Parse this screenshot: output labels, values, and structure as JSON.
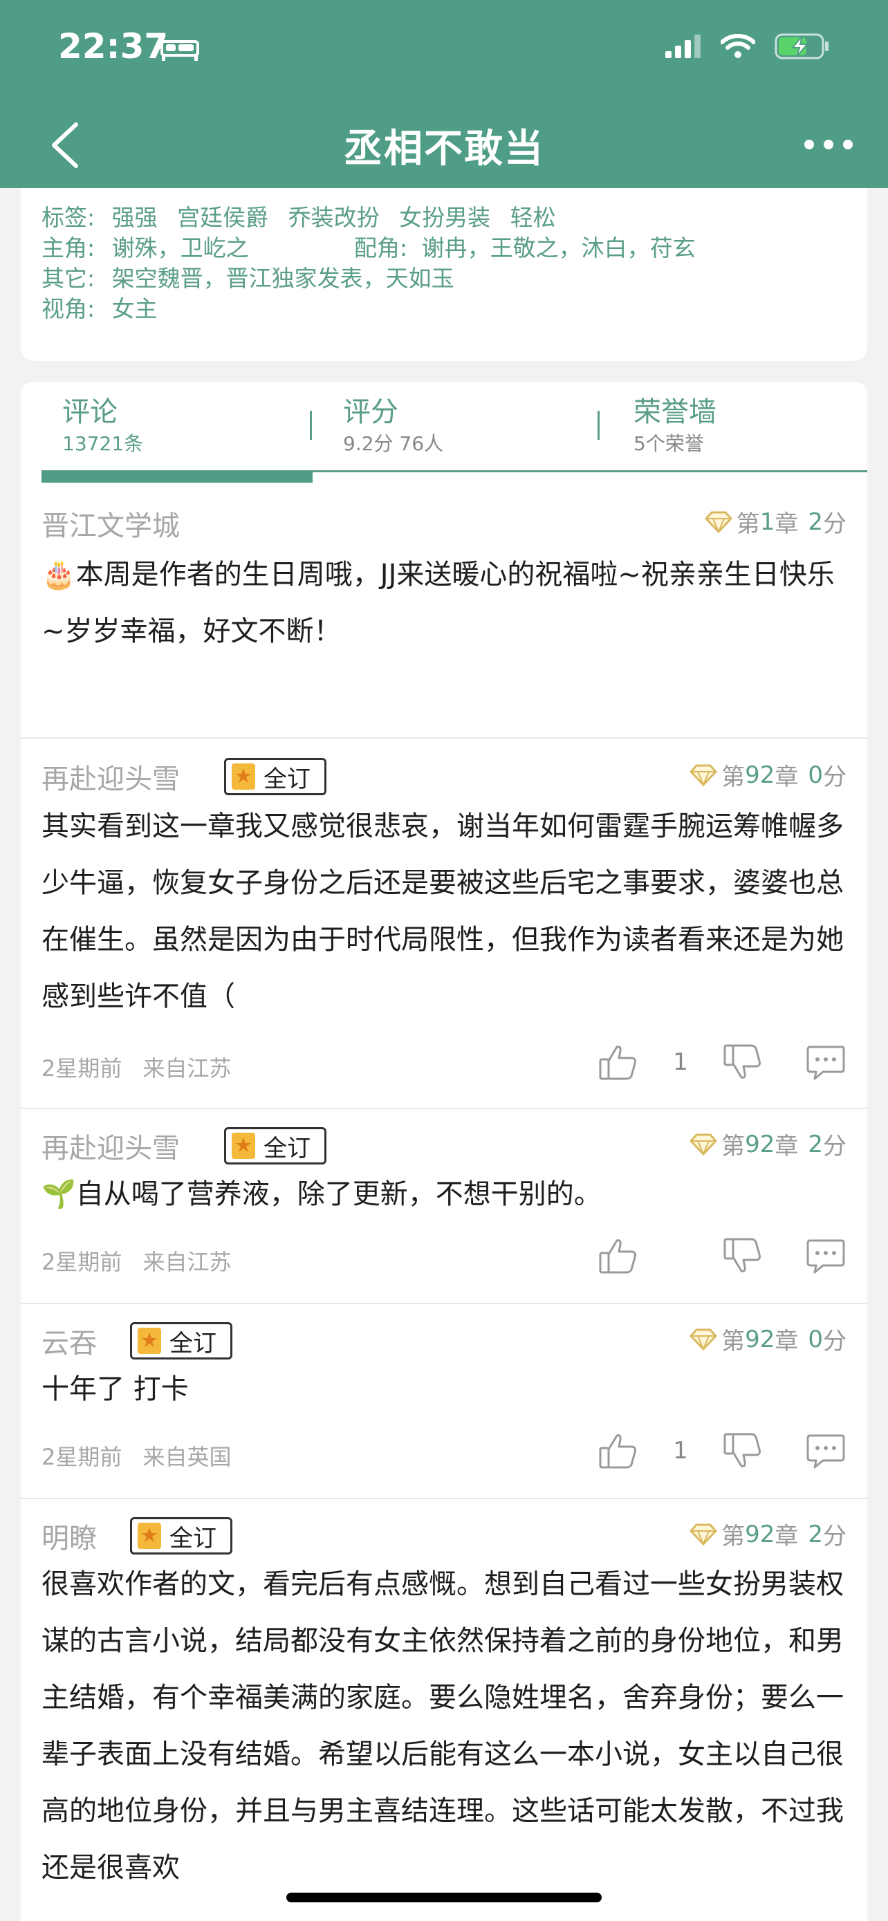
{
  "status": {
    "time": "22:37"
  },
  "nav": {
    "title": "丞相不敢当"
  },
  "info": {
    "tags_label": "标签:",
    "tags": [
      "强强",
      "宫廷侯爵",
      "乔装改扮",
      "女扮男装",
      "轻松"
    ],
    "lead_label": "主角:",
    "lead": "谢殊，卫屹之",
    "support_label": "配角:",
    "support": "谢冉，王敬之，沐白，苻玄",
    "other_label": "其它:",
    "other": "架空魏晋，晋江独家发表，天如玉",
    "pov_label": "视角:",
    "pov": "女主"
  },
  "tabs": [
    {
      "label": "评论",
      "sub": "13721条"
    },
    {
      "label": "评分",
      "sub": "9.2分 76人"
    },
    {
      "label": "荣誉墙",
      "sub": "5个荣誉"
    }
  ],
  "comments": [
    {
      "user": "晋江文学城",
      "badge": "",
      "chapter_prefix": "第",
      "chapter": "1",
      "chapter_suffix": "章",
      "score": "2",
      "score_suffix": "分",
      "body": "🎂本周是作者的生日周哦，JJ来送暖心的祝福啦~祝亲亲生日快乐~岁岁幸福，好文不断！",
      "time": "",
      "location": "",
      "likes": ""
    },
    {
      "user": "再赴迎头雪",
      "badge": "全订",
      "chapter_prefix": "第",
      "chapter": "92",
      "chapter_suffix": "章",
      "score": "0",
      "score_suffix": "分",
      "body": "其实看到这一章我又感觉很悲哀，谢当年如何雷霆手腕运筹帷幄多少牛逼，恢复女子身份之后还是要被这些后宅之事要求，婆婆也总在催生。虽然是因为由于时代局限性，但我作为读者看来还是为她感到些许不值（",
      "time": "2星期前",
      "location": "来自江苏",
      "likes": "1"
    },
    {
      "user": "再赴迎头雪",
      "badge": "全订",
      "chapter_prefix": "第",
      "chapter": "92",
      "chapter_suffix": "章",
      "score": "2",
      "score_suffix": "分",
      "body": "🌱自从喝了营养液，除了更新，不想干别的。",
      "time": "2星期前",
      "location": "来自江苏",
      "likes": ""
    },
    {
      "user": "云吞",
      "badge": "全订",
      "chapter_prefix": "第",
      "chapter": "92",
      "chapter_suffix": "章",
      "score": "0",
      "score_suffix": "分",
      "body": "十年了 打卡",
      "time": "2星期前",
      "location": "来自英国",
      "likes": "1"
    },
    {
      "user": "明瞭",
      "badge": "全订",
      "chapter_prefix": "第",
      "chapter": "92",
      "chapter_suffix": "章",
      "score": "2",
      "score_suffix": "分",
      "body": "很喜欢作者的文，看完后有点感慨。想到自己看过一些女扮男装权谋的古言小说，结局都没有女主依然保持着之前的身份地位，和男主结婚，有个幸福美满的家庭。要么隐姓埋名，舍弃身份；要么一辈子表面上没有结婚。希望以后能有这么一本小说，女主以自己很高的地位身份，并且与男主喜结连理。这些话可能太发散，不过我还是很喜欢",
      "time": "",
      "location": "",
      "likes": ""
    }
  ]
}
